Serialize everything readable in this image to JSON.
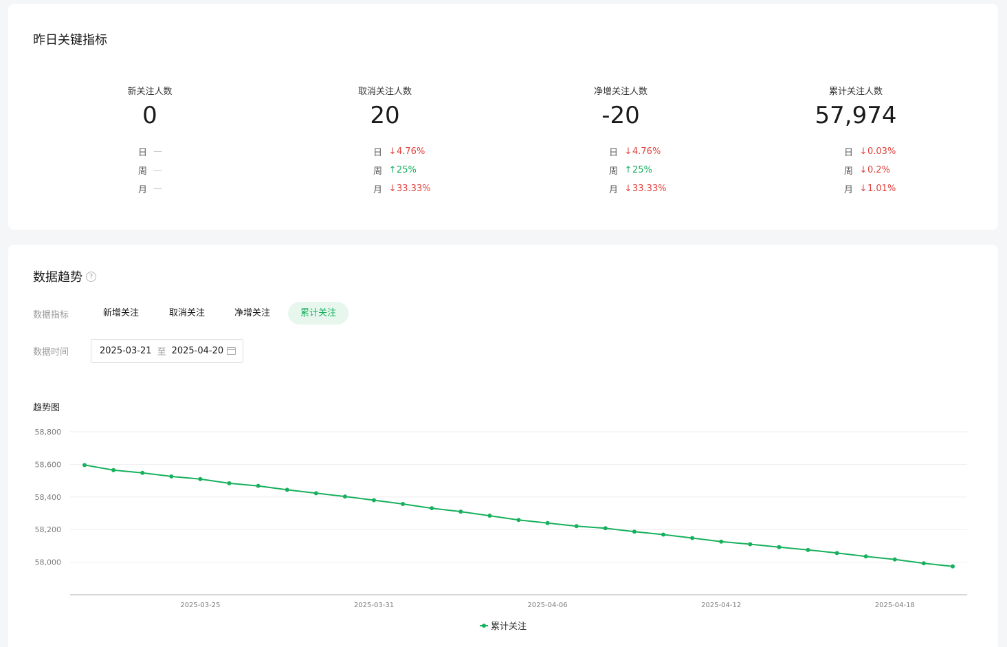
{
  "metrics_card": {
    "title": "昨日关键指标",
    "metrics": [
      {
        "label": "新关注人数",
        "value": "0",
        "changes": [
          {
            "period": "日",
            "arrow": "",
            "value": "—",
            "direction": "none"
          },
          {
            "period": "周",
            "arrow": "",
            "value": "—",
            "direction": "none"
          },
          {
            "period": "月",
            "arrow": "",
            "value": "—",
            "direction": "none"
          }
        ]
      },
      {
        "label": "取消关注人数",
        "value": "20",
        "changes": [
          {
            "period": "日",
            "arrow": "↓",
            "value": "4.76%",
            "direction": "down"
          },
          {
            "period": "周",
            "arrow": "↑",
            "value": "25%",
            "direction": "up"
          },
          {
            "period": "月",
            "arrow": "↓",
            "value": "33.33%",
            "direction": "down"
          }
        ]
      },
      {
        "label": "净增关注人数",
        "value": "-20",
        "changes": [
          {
            "period": "日",
            "arrow": "↓",
            "value": "4.76%",
            "direction": "down"
          },
          {
            "period": "周",
            "arrow": "↑",
            "value": "25%",
            "direction": "up"
          },
          {
            "period": "月",
            "arrow": "↓",
            "value": "33.33%",
            "direction": "down"
          }
        ]
      },
      {
        "label": "累计关注人数",
        "value": "57,974",
        "changes": [
          {
            "period": "日",
            "arrow": "↓",
            "value": "0.03%",
            "direction": "down"
          },
          {
            "period": "周",
            "arrow": "↓",
            "value": "0.2%",
            "direction": "down"
          },
          {
            "period": "月",
            "arrow": "↓",
            "value": "1.01%",
            "direction": "down"
          }
        ]
      }
    ]
  },
  "trend_card": {
    "title": "数据趋势",
    "help_icon": "?",
    "indicator_label": "数据指标",
    "tabs": [
      {
        "label": "新增关注",
        "active": false
      },
      {
        "label": "取消关注",
        "active": false
      },
      {
        "label": "净增关注",
        "active": false
      },
      {
        "label": "累计关注",
        "active": true
      }
    ],
    "time_label": "数据时间",
    "date_start": "2025-03-21",
    "date_separator": "至",
    "date_end": "2025-04-20",
    "chart_title": "趋势图"
  },
  "colors": {
    "accent": "#17b05d",
    "down": "#e0413d",
    "up": "#17b05d"
  },
  "chart_data": {
    "type": "line",
    "x": [
      "2025-03-21",
      "2025-03-22",
      "2025-03-23",
      "2025-03-24",
      "2025-03-25",
      "2025-03-26",
      "2025-03-27",
      "2025-03-28",
      "2025-03-29",
      "2025-03-30",
      "2025-03-31",
      "2025-04-01",
      "2025-04-02",
      "2025-04-03",
      "2025-04-04",
      "2025-04-05",
      "2025-04-06",
      "2025-04-07",
      "2025-04-08",
      "2025-04-09",
      "2025-04-10",
      "2025-04-11",
      "2025-04-12",
      "2025-04-13",
      "2025-04-14",
      "2025-04-15",
      "2025-04-16",
      "2025-04-17",
      "2025-04-18",
      "2025-04-19"
    ],
    "x_tick_labels": [
      "2025-03-25",
      "2025-03-31",
      "2025-04-06",
      "2025-04-12",
      "2025-04-18"
    ],
    "y_ticks": [
      58000,
      58200,
      58400,
      58600,
      58800
    ],
    "y_tick_labels": [
      "58,000",
      "58,200",
      "58,400",
      "58,600",
      "58,800"
    ],
    "ylim": [
      57800,
      58800
    ],
    "series": [
      {
        "name": "累计关注",
        "values": [
          58596,
          58565,
          58548,
          58526,
          58510,
          58484,
          58468,
          58444,
          58423,
          58403,
          58380,
          58357,
          58331,
          58310,
          58285,
          58259,
          58240,
          58221,
          58208,
          58187,
          58169,
          58148,
          58126,
          58110,
          58092,
          58075,
          58056,
          58035,
          58017,
          57993,
          57974
        ]
      }
    ],
    "grid": true,
    "legend": "bottom-center"
  }
}
